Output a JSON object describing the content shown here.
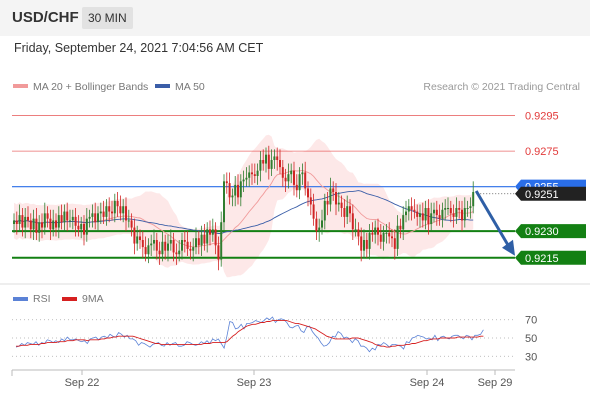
{
  "header": {
    "symbol": "USD/CHF",
    "timeframe": "30 MIN"
  },
  "timestamp": "Friday, September 24, 2021 7:04:56 AM CET",
  "copyright": "Research © 2021 Trading Central",
  "legend": {
    "ma20_label": "MA 20 + Bollinger Bands",
    "ma50_label": "MA 50",
    "rsi_label": "RSI",
    "ma9_label": "9MA"
  },
  "colors": {
    "resistance": "#e23b3b",
    "support": "#138013",
    "current": "#2a6ee8",
    "ma20": "#f19a9a",
    "ma50": "#3b5ea8",
    "bollinger_fill": "#fde4e4",
    "rsi": "#5b82d6",
    "rsi_ma": "#d62020",
    "candle_up": "#2f7d2f",
    "candle_down": "#d02424",
    "arrow": "#2f5fa6"
  },
  "chart_data": [
    {
      "type": "candlestick",
      "title": "USD/CHF",
      "x_ticks": [
        "Sep 22",
        "Sep 23",
        "Sep 24",
        "Sep 29"
      ],
      "ylim": [
        0.9207,
        0.9306
      ],
      "levels": [
        {
          "value": 0.9295,
          "label": "0.9295",
          "kind": "resistance"
        },
        {
          "value": 0.9275,
          "label": "0.9275",
          "kind": "resistance"
        },
        {
          "value": 0.9255,
          "label": "0.9255",
          "kind": "current"
        },
        {
          "value": 0.9251,
          "label": "0.9251",
          "kind": "last"
        },
        {
          "value": 0.923,
          "label": "0.9230",
          "kind": "support"
        },
        {
          "value": 0.9215,
          "label": "0.9215",
          "kind": "support"
        }
      ],
      "close": [
        0.9236,
        0.9234,
        0.9239,
        0.9232,
        0.9238,
        0.9236,
        0.9231,
        0.9237,
        0.9229,
        0.9235,
        0.9232,
        0.924,
        0.9237,
        0.9231,
        0.9236,
        0.9232,
        0.9239,
        0.9235,
        0.9241,
        0.9236,
        0.9236,
        0.9238,
        0.9233,
        0.9231,
        0.9234,
        0.9228,
        0.9237,
        0.9238,
        0.924,
        0.9235,
        0.924,
        0.9241,
        0.9238,
        0.9244,
        0.9241,
        0.924,
        0.9247,
        0.9244,
        0.924,
        0.9244,
        0.9236,
        0.9236,
        0.9232,
        0.9223,
        0.9227,
        0.9225,
        0.9221,
        0.9217,
        0.9222,
        0.9223,
        0.9225,
        0.9219,
        0.9217,
        0.9224,
        0.9219,
        0.9223,
        0.9225,
        0.9218,
        0.9217,
        0.9219,
        0.9225,
        0.9224,
        0.922,
        0.9219,
        0.9221,
        0.9226,
        0.9222,
        0.9228,
        0.9223,
        0.9231,
        0.9228,
        0.9231,
        0.9222,
        0.9214,
        0.9235,
        0.9258,
        0.9257,
        0.9249,
        0.925,
        0.9256,
        0.9249,
        0.9258,
        0.9259,
        0.926,
        0.9263,
        0.9262,
        0.9261,
        0.9264,
        0.927,
        0.9268,
        0.9273,
        0.9265,
        0.927,
        0.9272,
        0.927,
        0.9266,
        0.926,
        0.9258,
        0.9262,
        0.9264,
        0.9256,
        0.9253,
        0.9262,
        0.9263,
        0.9254,
        0.9249,
        0.9245,
        0.9237,
        0.923,
        0.9232,
        0.9236,
        0.9247,
        0.9245,
        0.9254,
        0.9252,
        0.9245,
        0.9246,
        0.9243,
        0.9238,
        0.9244,
        0.924,
        0.9231,
        0.9231,
        0.9227,
        0.9219,
        0.9225,
        0.922,
        0.9229,
        0.9228,
        0.9232,
        0.9228,
        0.9224,
        0.9229,
        0.9229,
        0.9227,
        0.9226,
        0.922,
        0.9233,
        0.9231,
        0.9239,
        0.9241,
        0.9244,
        0.9242,
        0.9241,
        0.9238,
        0.924,
        0.9236,
        0.9243,
        0.9234,
        0.924,
        0.9242,
        0.9239,
        0.9237,
        0.9242,
        0.9243,
        0.9243,
        0.924,
        0.9238,
        0.9243,
        0.9242,
        0.9236,
        0.9243,
        0.9243,
        0.9244,
        0.9252
      ]
    },
    {
      "type": "line",
      "title": "RSI",
      "y_ticks": [
        70,
        50,
        30
      ],
      "ylim": [
        15,
        85
      ],
      "series": [
        {
          "name": "RSI",
          "values": [
            40,
            41,
            44,
            42,
            45,
            44,
            43,
            46,
            42,
            45,
            44,
            48,
            47,
            45,
            47,
            45,
            49,
            47,
            51,
            48,
            48,
            49,
            47,
            46,
            47,
            44,
            49,
            50,
            51,
            48,
            51,
            52,
            50,
            54,
            52,
            51,
            56,
            54,
            51,
            53,
            49,
            49,
            47,
            42,
            45,
            44,
            42,
            40,
            43,
            44,
            45,
            42,
            41,
            45,
            42,
            44,
            45,
            41,
            41,
            42,
            46,
            45,
            43,
            42,
            43,
            46,
            44,
            47,
            44,
            49,
            47,
            49,
            44,
            39,
            52,
            68,
            67,
            60,
            61,
            65,
            60,
            66,
            66,
            67,
            69,
            68,
            67,
            69,
            72,
            70,
            73,
            67,
            70,
            71,
            70,
            67,
            62,
            61,
            63,
            64,
            58,
            56,
            62,
            63,
            57,
            53,
            50,
            45,
            41,
            42,
            45,
            52,
            51,
            57,
            55,
            50,
            51,
            49,
            45,
            49,
            47,
            41,
            41,
            39,
            35,
            39,
            37,
            43,
            42,
            45,
            43,
            40,
            43,
            43,
            42,
            41,
            38,
            46,
            45,
            50,
            51,
            53,
            52,
            51,
            49,
            50,
            48,
            53,
            47,
            51,
            52,
            50,
            49,
            52,
            53,
            53,
            51,
            49,
            53,
            52,
            48,
            53,
            53,
            54,
            59
          ]
        },
        {
          "name": "9MA",
          "values": [
            41,
            41,
            42,
            42,
            42,
            43,
            43,
            43,
            43,
            44,
            44,
            45,
            45,
            45,
            45,
            46,
            46,
            46,
            47,
            47,
            47,
            48,
            48,
            48,
            48,
            47,
            48,
            48,
            48,
            48,
            49,
            49,
            50,
            50,
            51,
            51,
            52,
            52,
            52,
            52,
            52,
            52,
            51,
            50,
            49,
            48,
            47,
            46,
            45,
            44,
            44,
            43,
            43,
            43,
            43,
            43,
            43,
            43,
            43,
            43,
            43,
            43,
            43,
            43,
            43,
            43,
            44,
            44,
            44,
            45,
            45,
            45,
            45,
            45,
            46,
            49,
            52,
            54,
            57,
            59,
            61,
            63,
            64,
            65,
            65,
            66,
            67,
            67,
            68,
            68,
            69,
            69,
            69,
            69,
            69,
            69,
            68,
            67,
            66,
            66,
            65,
            64,
            63,
            62,
            61,
            60,
            58,
            56,
            54,
            52,
            51,
            50,
            49,
            49,
            49,
            49,
            49,
            49,
            50,
            50,
            50,
            49,
            48,
            47,
            46,
            45,
            43,
            42,
            41,
            41,
            40,
            40,
            41,
            41,
            42,
            42,
            42,
            43,
            43,
            44,
            44,
            45,
            46,
            47,
            47,
            48,
            49,
            49,
            49,
            50,
            50,
            50,
            50,
            50,
            50,
            51,
            51,
            51,
            51,
            51,
            51,
            51,
            51,
            52,
            52
          ]
        }
      ]
    }
  ]
}
